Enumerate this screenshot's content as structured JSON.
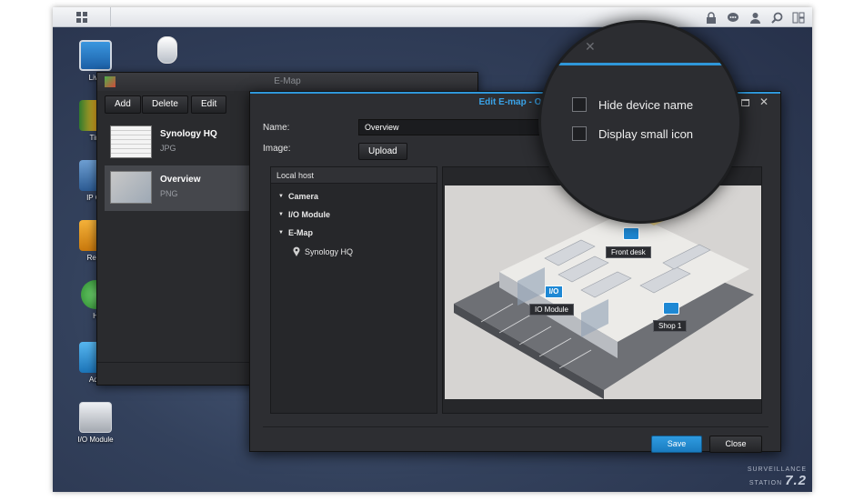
{
  "desktop_icons": [
    {
      "label": "Live",
      "color": "#2a7bc7"
    },
    {
      "label": "Tim",
      "color": "#3c8f3a"
    },
    {
      "label": "IP Ca",
      "color": "#3f6ea6"
    },
    {
      "label": "Reco",
      "color": "#d08b17"
    },
    {
      "label": "H",
      "color": "#3aa04a"
    },
    {
      "label": "Add",
      "color": "#2f8fd0"
    },
    {
      "label": "I/O Module",
      "color": "#7a7d84"
    }
  ],
  "emap_window": {
    "title": "E-Map",
    "toolbar": {
      "add": "Add",
      "delete": "Delete",
      "edit": "Edit"
    },
    "maps": [
      {
        "name": "Synology HQ",
        "type": "JPG"
      },
      {
        "name": "Overview",
        "type": "PNG"
      }
    ]
  },
  "edit_window": {
    "title": "Edit E-map - Ove",
    "name_label": "Name:",
    "name_value": "Overview",
    "image_label": "Image:",
    "upload": "Upload",
    "tree": {
      "header": "Local host",
      "items": [
        "Camera",
        "I/O Module",
        "E-Map"
      ],
      "child": "Synology HQ"
    },
    "map_labels": {
      "front_desk": "Front desk",
      "io_module": "IO Module",
      "shop1": "Shop 1",
      "io_badge": "I/O"
    },
    "save": "Save",
    "close": "Close"
  },
  "magnifier": {
    "options": [
      "Hide device name",
      "Display small icon"
    ]
  },
  "brand": {
    "line1": "SURVEILLANCE",
    "line2": "STATION",
    "version": "7.2"
  },
  "colors": {
    "accent": "#2f97d9",
    "save": "#1f87cf"
  }
}
